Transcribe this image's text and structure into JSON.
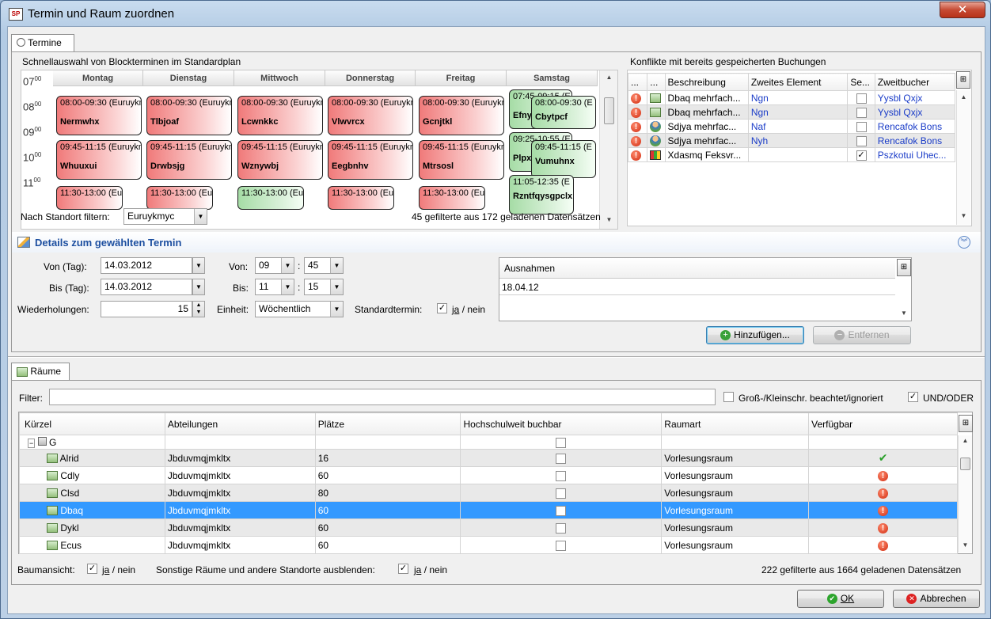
{
  "window": {
    "title": "Termin und Raum zuordnen",
    "app_icon": "SP",
    "close": "✕"
  },
  "termine_tab": {
    "label": "Termine"
  },
  "schnell": {
    "title": "Schnellauswahl von Blockterminen im Standardplan",
    "hours": [
      "07",
      "08",
      "09",
      "10",
      "11"
    ],
    "hour_suffix": "00",
    "days": [
      "Montag",
      "Dienstag",
      "Mittwoch",
      "Donnerstag",
      "Freitag",
      "Samstag"
    ],
    "events": {
      "r1": [
        {
          "time": "08:00-09:30 (Euruykm",
          "name": "Nermwhx"
        },
        {
          "time": "08:00-09:30 (Euruykm",
          "name": "Tlbjoaf"
        },
        {
          "time": "08:00-09:30 (Euruykm",
          "name": "Lcwnkkc"
        },
        {
          "time": "08:00-09:30 (Euruykm",
          "name": "Vlwvrcx"
        },
        {
          "time": "08:00-09:30 (Euruykm",
          "name": "Gcnjtkl"
        }
      ],
      "r2": [
        {
          "time": "09:45-11:15 (Euruykm",
          "name": "Whuuxui"
        },
        {
          "time": "09:45-11:15 (Euruykm",
          "name": "Drwbsjg"
        },
        {
          "time": "09:45-11:15 (Euruykm",
          "name": "Wznywbj"
        },
        {
          "time": "09:45-11:15 (Euruykm",
          "name": "Eegbnhv"
        },
        {
          "time": "09:45-11:15 (Euruykm",
          "name": "Mtrsosl"
        }
      ],
      "r3": [
        {
          "time": "11:30-13:00 (Eu"
        },
        {
          "time": "11:30-13:00 (Eu"
        },
        {
          "time": "11:30-13:00 (Eu"
        },
        {
          "time": "11:30-13:00 (Eu"
        },
        {
          "time": "11:30-13:00 (Eu"
        }
      ],
      "sat": [
        {
          "time": "07:45-09:15 (E",
          "name": "Efnyo"
        },
        {
          "time": "08:00-09:30 (E",
          "name": "Cbytpcf"
        },
        {
          "time": "09:25-10:55 (E",
          "name": "Plpxl"
        },
        {
          "time": "09:45-11:15 (E",
          "name": "Vumuhnx"
        },
        {
          "time": "11:05-12:35 (E",
          "name": "Rzntfqysgpclx"
        }
      ]
    },
    "filter_label": "Nach Standort filtern:",
    "filter_value": "Euruykmyc",
    "count": "45 gefilterte aus 172 geladenen Datensätzen"
  },
  "konflikte": {
    "title": "Konflikte mit bereits gespeicherten Buchungen",
    "headers": [
      "...",
      "...",
      "Beschreibung",
      "Zweites Element",
      "Se...",
      "Zweitbucher"
    ],
    "rows": [
      {
        "icon": "room-icon",
        "desc": "Dbaq mehrfach...",
        "second": "Ngn",
        "checked": "",
        "booker": "Yysbl Qxjx"
      },
      {
        "icon": "room-icon",
        "desc": "Dbaq mehrfach...",
        "second": "Ngn",
        "checked": "",
        "booker": "Yysbl Qxjx"
      },
      {
        "icon": "person-icon",
        "desc": "Sdjya mehrfac...",
        "second": "Naf",
        "checked": "",
        "booker": "Rencafok Bons"
      },
      {
        "icon": "person-icon",
        "desc": "Sdjya mehrfac...",
        "second": "Nyh",
        "checked": "",
        "booker": "Rencafok Bons"
      },
      {
        "icon": "chart-icon",
        "desc": "Xdasmq Feksvr...",
        "second": "",
        "checked": "✓",
        "booker": "Pszkotui Uhec..."
      }
    ]
  },
  "details": {
    "title": "Details zum gewählten Termin",
    "von_tag_label": "Von (Tag):",
    "von_tag": "14.03.2012",
    "bis_tag_label": "Bis (Tag):",
    "bis_tag": "14.03.2012",
    "wdh_label": "Wiederholungen:",
    "wdh": "15",
    "von_label": "Von:",
    "von_h": "09",
    "von_m": "45",
    "bis_label": "Bis:",
    "bis_h": "11",
    "bis_m": "15",
    "sep": ":",
    "einheit_label": "Einheit:",
    "einheit": "Wöchentlich",
    "standard_label": "Standardtermin:",
    "ja": "ja",
    "nein": "/ nein",
    "ausnahmen_header": "Ausnahmen",
    "ausnahmen": [
      "18.04.12"
    ],
    "add_btn": "Hinzufügen...",
    "remove_btn": "Entfernen"
  },
  "raeume_tab": {
    "label": "Räume"
  },
  "raeume": {
    "filter_label": "Filter:",
    "filter_value": "",
    "case_label": "Groß-/Kleinschr. beachtet/ignoriert",
    "undoder": "UND/ODER",
    "headers": [
      "Kürzel",
      "Abteilungen",
      "Plätze",
      "Hochschulweit buchbar",
      "Raumart",
      "Verfügbar"
    ],
    "group": "G",
    "rows": [
      {
        "kuerzel": "Alrid",
        "abt": "Jbduvmqjmkltx",
        "plaetze": "16",
        "art": "Vorlesungsraum",
        "status": "ok"
      },
      {
        "kuerzel": "Cdly",
        "abt": "Jbduvmqjmkltx",
        "plaetze": "60",
        "art": "Vorlesungsraum",
        "status": "conflict"
      },
      {
        "kuerzel": "Clsd",
        "abt": "Jbduvmqjmkltx",
        "plaetze": "80",
        "art": "Vorlesungsraum",
        "status": "conflict"
      },
      {
        "kuerzel": "Dbaq",
        "abt": "Jbduvmqjmkltx",
        "plaetze": "60",
        "art": "Vorlesungsraum",
        "status": "conflict",
        "selected": true
      },
      {
        "kuerzel": "Dykl",
        "abt": "Jbduvmqjmkltx",
        "plaetze": "60",
        "art": "Vorlesungsraum",
        "status": "conflict"
      },
      {
        "kuerzel": "Ecus",
        "abt": "Jbduvmqjmkltx",
        "plaetze": "60",
        "art": "Vorlesungsraum",
        "status": "conflict"
      }
    ],
    "baum_label": "Baumansicht:",
    "sonstige_label": "Sonstige Räume und andere Standorte ausblenden:",
    "count": "222 gefilterte aus 1664 geladenen Datensätzen"
  },
  "footer": {
    "ok": "OK",
    "cancel": "Abbrechen"
  },
  "colors": {
    "selection": "#3399ff",
    "event_red": "#f07a7a",
    "event_green": "#a6dca6",
    "link": "#1a3cc8"
  }
}
